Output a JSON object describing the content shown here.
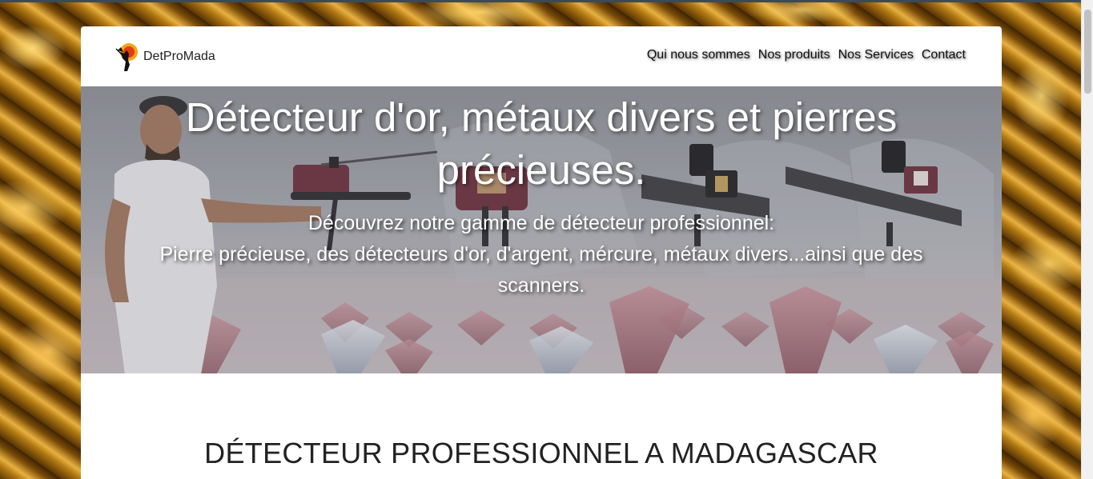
{
  "brand": {
    "name": "DetProMada",
    "logo_icon": "gold-miner-silhouette-icon"
  },
  "nav": {
    "items": [
      {
        "label": "Qui nous sommes"
      },
      {
        "label": "Nos produits"
      },
      {
        "label": "Nos Services"
      },
      {
        "label": "Contact"
      }
    ]
  },
  "hero": {
    "title": "Détecteur d'or, métaux divers et pierres précieuses.",
    "subtitle_line1": "Découvrez notre gamme de détecteur professionnel:",
    "subtitle_line2": "Pierre précieuse, des détecteurs d'or, d'argent, mércure, métaux divers...ainsi que des scanners."
  },
  "section": {
    "title": "DÉTECTEUR PROFESSIONNEL A MADAGASCAR"
  },
  "colors": {
    "background_texture": "#b07912",
    "container": "#ffffff",
    "hero_text": "#ffffff",
    "nav_text": "#111111"
  }
}
